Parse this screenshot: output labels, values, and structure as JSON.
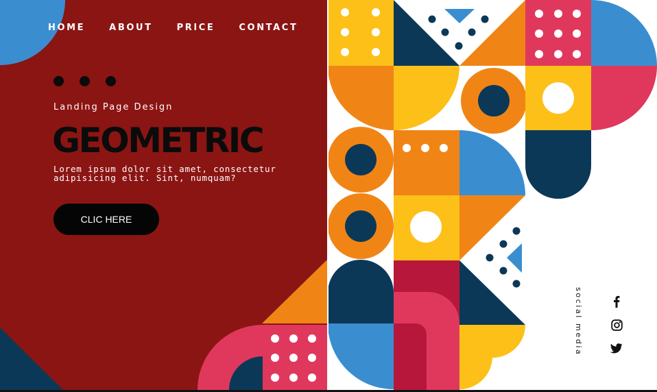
{
  "nav": {
    "items": [
      {
        "label": "HOME"
      },
      {
        "label": "ABOUT"
      },
      {
        "label": "PRICE"
      },
      {
        "label": "CONTACT"
      }
    ]
  },
  "hero": {
    "kicker": "Landing Page Design",
    "title": "GEOMETRIC",
    "body": "Lorem ipsum dolor sit amet, consectetur adipisicing elit. Sint, numquam?",
    "cta_label": "CLIC HERE"
  },
  "social": {
    "label": "social media",
    "icons": [
      "facebook-icon",
      "instagram-icon",
      "twitter-icon"
    ]
  },
  "palette": {
    "maroon": "#8B1513",
    "navy": "#0C3858",
    "orange": "#F08516",
    "yellow": "#FCC019",
    "pink": "#E0385C",
    "crimson": "#B8173C",
    "blue": "#3A8ED0",
    "white": "#FFFFFF",
    "black": "#050505"
  }
}
